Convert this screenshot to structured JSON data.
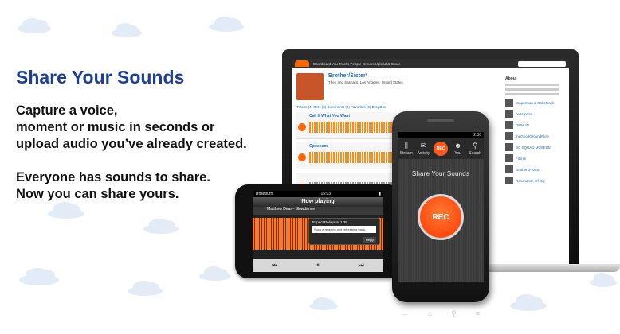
{
  "hero": {
    "headline": "Share Your Sounds",
    "paragraph1": [
      "Capture a voice,",
      "moment or music in seconds or",
      "upload audio you’ve already created."
    ],
    "paragraph2": [
      "Everyone has sounds to share.",
      "Now you can share yours."
    ]
  },
  "colors": {
    "headline": "#1c3e9b",
    "accent": "#ff5a1e"
  },
  "laptop": {
    "nav": "Dashboard  You  Tracks  People  Groups    Upload & Share",
    "profile_name": "Brother/Sister*",
    "profile_location": "Theo and Sasha S, Los Angeles, United States",
    "tabs": "Tracks (4)   Sets (0)   Comments (0)   Favorites (0)   DropBox",
    "tracks": [
      {
        "title": "Call It What You Want"
      },
      {
        "title": "Opossum"
      }
    ],
    "sidebar_title": "About",
    "followers": [
      "Waperman & BaksTrack",
      "beastprom",
      "DMHUN",
      "theGoodGroundFlow",
      "BC SQUAD MUSEUM",
      "Fitkreli",
      "BrothersFromin",
      "Resonance Of Big"
    ]
  },
  "iphone": {
    "carrier": "Trolleburn",
    "time": "15:03",
    "title": "Now playing",
    "track_title": "Matthew Dear - Slowdance",
    "track_user": "ghostly",
    "popup_title": "Expect Delays at 1:38",
    "popup_body": "Such a relaxing and refreshing track.",
    "reply": "Reply",
    "controls": [
      "⏮",
      "⏸",
      "⏭"
    ]
  },
  "android": {
    "time": "2:30",
    "tabs": [
      {
        "icon": "waveform-icon",
        "glyph": "⫼",
        "label": "Stream"
      },
      {
        "icon": "comment-icon",
        "glyph": "✉",
        "label": "Activity"
      },
      {
        "icon": "rec-icon",
        "glyph": "REC",
        "label": ""
      },
      {
        "icon": "person-icon",
        "glyph": "☻",
        "label": "You"
      },
      {
        "icon": "search-icon",
        "glyph": "⚲",
        "label": "Search"
      }
    ],
    "heading": "Share Your Sounds",
    "rec_label": "REC",
    "nav": [
      "←",
      "⌂",
      "⚲",
      "≡"
    ]
  }
}
